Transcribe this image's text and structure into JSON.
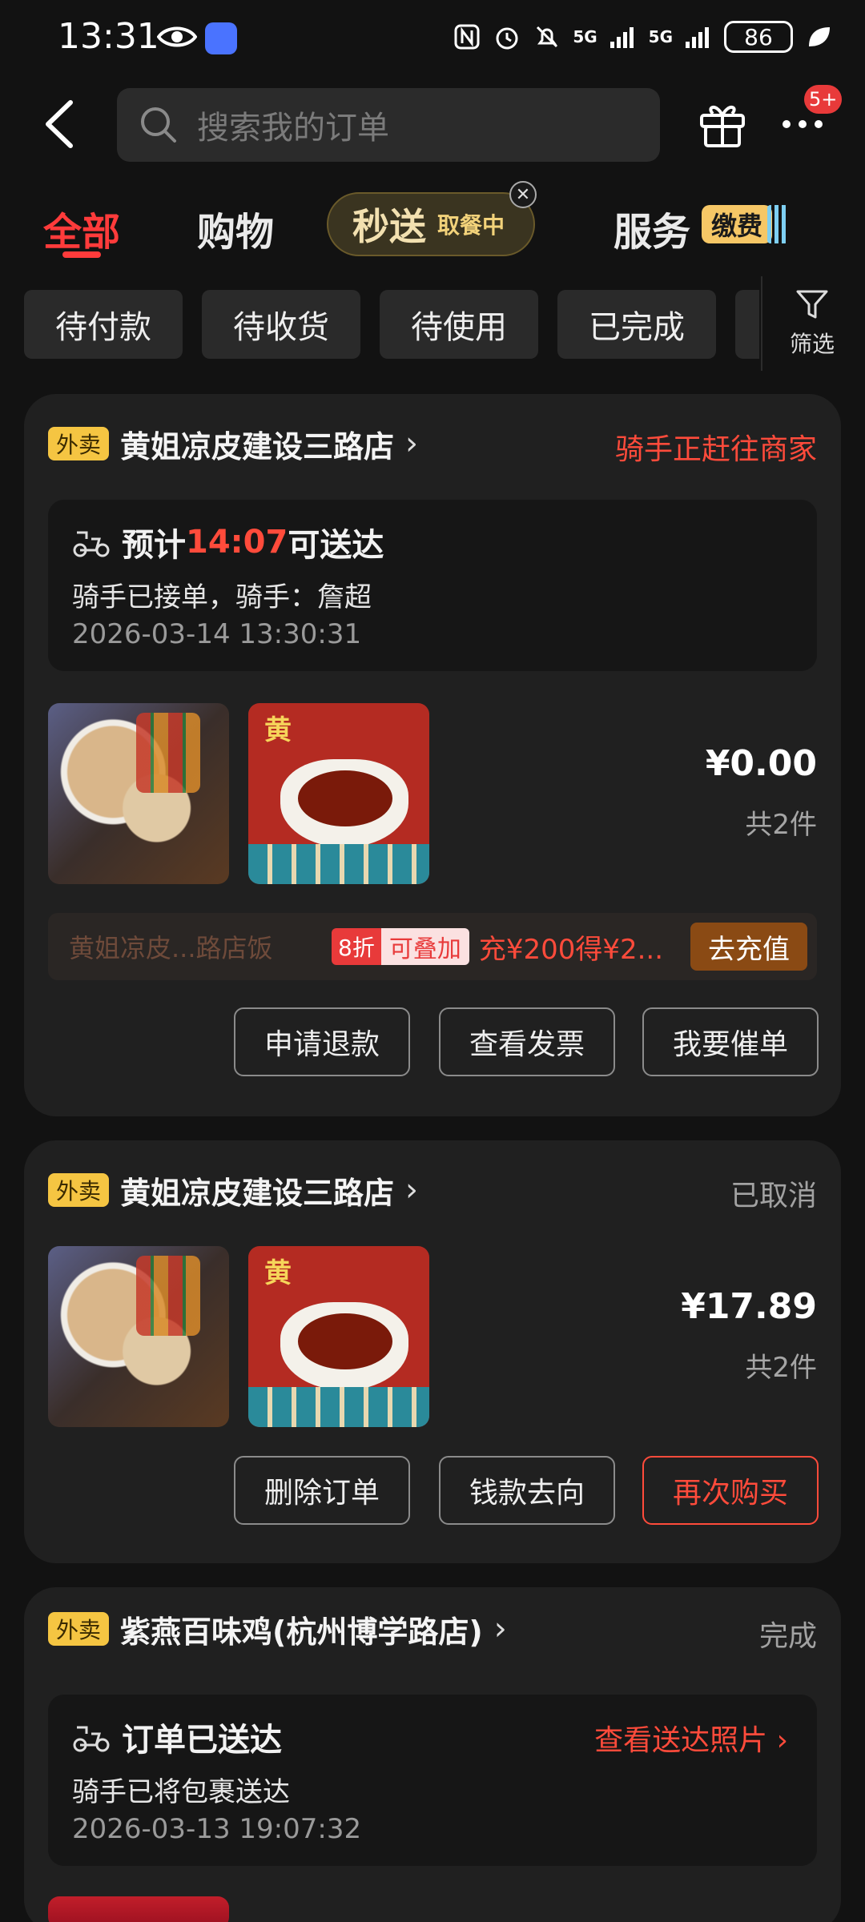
{
  "status_bar": {
    "time": "13:31",
    "net1": "5G",
    "net2": "5G",
    "battery": "86"
  },
  "header": {
    "search_placeholder": "搜索我的订单",
    "notification_badge": "5+"
  },
  "tabs": {
    "all": "全部",
    "shopping": "购物",
    "express": "秒送",
    "express_sub": "取餐中",
    "service": "服务",
    "service_badge": "缴费"
  },
  "filters": {
    "chips": [
      "待付款",
      "待收货",
      "待使用",
      "已完成"
    ],
    "filter_label": "筛选"
  },
  "orders": [
    {
      "tag": "外卖",
      "store": "黄姐凉皮建设三路店",
      "status": "骑手正赶往商家",
      "delivery_prefix": "预计",
      "delivery_time": "14:07",
      "delivery_suffix": "可送达",
      "rider_info": "骑手已接单，骑手：詹超",
      "timestamp": "2026-03-14 13:30:31",
      "price": "¥0.00",
      "count": "共2件",
      "promo_store": "黄姐凉皮...路店饭",
      "promo_discount": "8折",
      "promo_stack": "可叠加",
      "promo_offer": "充¥200得¥2...",
      "promo_button": "去充值",
      "buttons": [
        "申请退款",
        "查看发票",
        "我要催单"
      ]
    },
    {
      "tag": "外卖",
      "store": "黄姐凉皮建设三路店",
      "status": "已取消",
      "price": "¥17.89",
      "count": "共2件",
      "buttons": [
        "删除订单",
        "钱款去向",
        "再次购买"
      ]
    },
    {
      "tag": "外卖",
      "store": "紫燕百味鸡(杭州博学路店)",
      "status": "完成",
      "delivery_title": "订单已送达",
      "delivery_link": "查看送达照片",
      "rider_info": "骑手已将包裹送达",
      "timestamp": "2026-03-13 19:07:32"
    }
  ],
  "colors": {
    "accent_red": "#ff3b3b",
    "tag_yellow": "#f5c542",
    "background": "#121212",
    "card": "#202020"
  }
}
